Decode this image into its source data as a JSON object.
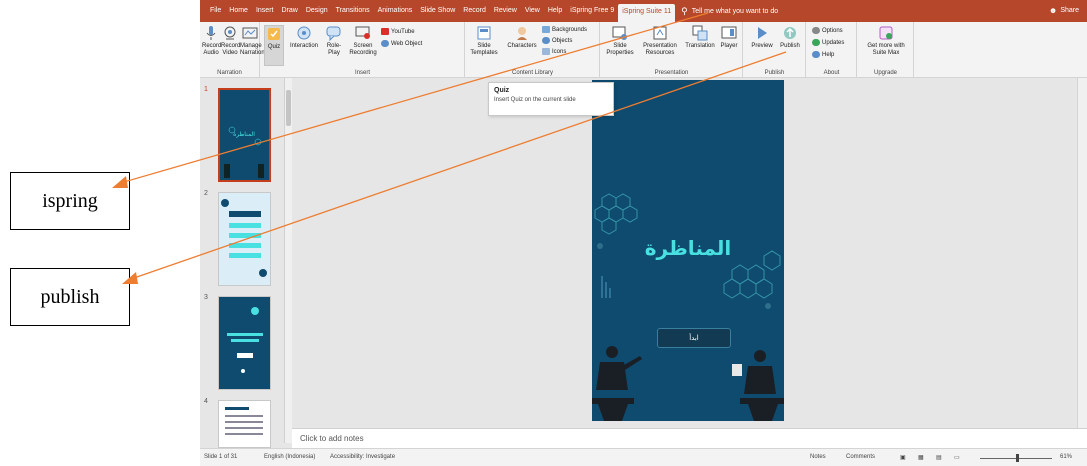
{
  "tabs": [
    "File",
    "Home",
    "Insert",
    "Draw",
    "Design",
    "Transitions",
    "Animations",
    "Slide Show",
    "Record",
    "Review",
    "View",
    "Help",
    "iSpring Free 9",
    "iSpring Suite 11"
  ],
  "tell_me": "Tell me what you want to do",
  "share": "Share",
  "ribbon": {
    "narration": {
      "label": "Narration",
      "record_audio": [
        "Record",
        "Audio"
      ],
      "record_video": [
        "Record",
        "Video"
      ],
      "manage_narration": [
        "Manage",
        "Narration"
      ]
    },
    "insert": {
      "label": "Insert",
      "quiz": "Quiz",
      "interaction": "Interaction",
      "role_play": [
        "Role-",
        "Play"
      ],
      "screen_recording": [
        "Screen",
        "Recording"
      ],
      "youtube": "YouTube",
      "web_object": "Web Object"
    },
    "content_library": {
      "label": "Content Library",
      "slide_templates": [
        "Slide",
        "Templates"
      ],
      "characters": "Characters",
      "backgrounds": "Backgrounds",
      "objects": "Objects",
      "icons": "Icons"
    },
    "presentation": {
      "label": "Presentation",
      "slide_properties": [
        "Slide",
        "Properties"
      ],
      "presentation_resources": [
        "Presentation",
        "Resources"
      ],
      "translation": "Translation",
      "player": "Player"
    },
    "publish": {
      "label": "Publish",
      "preview": "Preview",
      "publish": "Publish"
    },
    "about": {
      "label": "About",
      "options": "Options",
      "updates": "Updates",
      "help": "Help"
    },
    "upgrade": {
      "label": "Upgrade",
      "get_more": [
        "Get more with",
        "Suite Max"
      ]
    }
  },
  "tooltip": {
    "title": "Quiz",
    "desc": "Insert Quiz on the current slide"
  },
  "thumbnails": [
    "1",
    "2",
    "3",
    "4"
  ],
  "slide": {
    "title": "المناظرة",
    "button": "ابدأ"
  },
  "notes_placeholder": "Click to add notes",
  "status": {
    "slide": "Slide 1 of 31",
    "language": "English (Indonesia)",
    "accessibility": "Accessibility: Investigate",
    "notes": "Notes",
    "comments": "Comments",
    "zoom": "61%"
  },
  "annotations": {
    "ispring": "ispring",
    "publish": "publish"
  },
  "colors": {
    "accent": "#b7472a",
    "slide_bg": "#0e4b6e",
    "slide_title": "#48e0e0",
    "arrow": "#ed7d31"
  }
}
